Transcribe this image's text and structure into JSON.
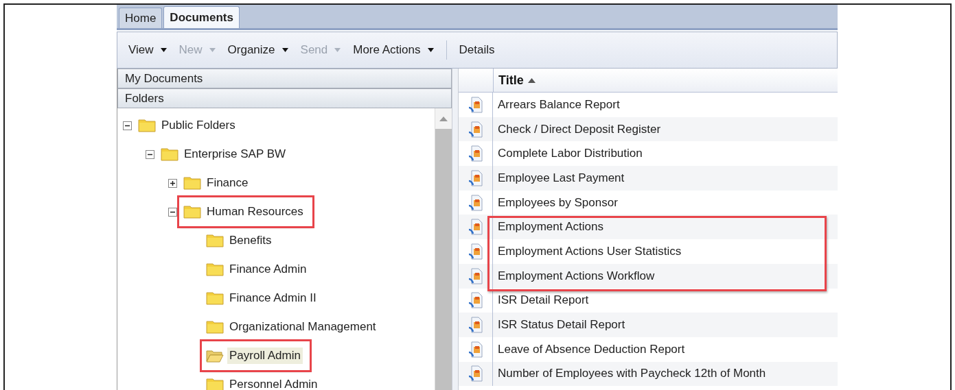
{
  "tabs": [
    {
      "label": "Home",
      "selected": false
    },
    {
      "label": "Documents",
      "selected": true
    }
  ],
  "toolbar": [
    {
      "label": "View",
      "disabled": false,
      "kind": "menu"
    },
    {
      "label": "New",
      "disabled": true,
      "kind": "menu"
    },
    {
      "label": "Organize",
      "disabled": false,
      "kind": "menu"
    },
    {
      "label": "Send",
      "disabled": true,
      "kind": "menu"
    },
    {
      "label": "More Actions",
      "disabled": false,
      "kind": "menu"
    },
    {
      "label": "Details",
      "disabled": false,
      "kind": "button"
    }
  ],
  "sidebar": {
    "sections": [
      "My Documents",
      "Folders"
    ],
    "tree": [
      {
        "label": "Public Folders",
        "expanded": true,
        "selected": false,
        "highlighted": false,
        "children": [
          {
            "label": "Enterprise SAP BW",
            "expanded": true,
            "selected": false,
            "highlighted": false,
            "children": [
              {
                "label": "Finance",
                "expanded": false,
                "selected": false,
                "highlighted": false
              },
              {
                "label": "Human Resources",
                "expanded": true,
                "selected": false,
                "highlighted": true,
                "children": [
                  {
                    "label": "Benefits",
                    "selected": false,
                    "highlighted": false
                  },
                  {
                    "label": "Finance Admin",
                    "selected": false,
                    "highlighted": false
                  },
                  {
                    "label": "Finance Admin II",
                    "selected": false,
                    "highlighted": false
                  },
                  {
                    "label": "Organizational Management",
                    "selected": false,
                    "highlighted": false
                  },
                  {
                    "label": "Payroll Admin",
                    "selected": true,
                    "highlighted": true
                  },
                  {
                    "label": "Personnel Admin",
                    "selected": false,
                    "highlighted": false
                  }
                ]
              }
            ]
          }
        ]
      }
    ]
  },
  "table": {
    "columns": [
      "Title"
    ],
    "rows": [
      {
        "title": "Arrears Balance Report",
        "highlighted": false
      },
      {
        "title": "Check / Direct Deposit Register",
        "highlighted": false
      },
      {
        "title": "Complete Labor Distribution",
        "highlighted": false
      },
      {
        "title": "Employee Last Payment",
        "highlighted": false
      },
      {
        "title": "Employees by Sponsor",
        "highlighted": false
      },
      {
        "title": "Employment Actions",
        "highlighted": true
      },
      {
        "title": "Employment Actions User Statistics",
        "highlighted": true
      },
      {
        "title": "Employment Actions Workflow",
        "highlighted": true
      },
      {
        "title": "ISR Detail Report",
        "highlighted": false
      },
      {
        "title": "ISR Status Detail Report",
        "highlighted": false
      },
      {
        "title": "Leave of Absence Deduction Report",
        "highlighted": false
      },
      {
        "title": "Number of Employees with Paycheck 12th of Month",
        "highlighted": false
      }
    ]
  }
}
